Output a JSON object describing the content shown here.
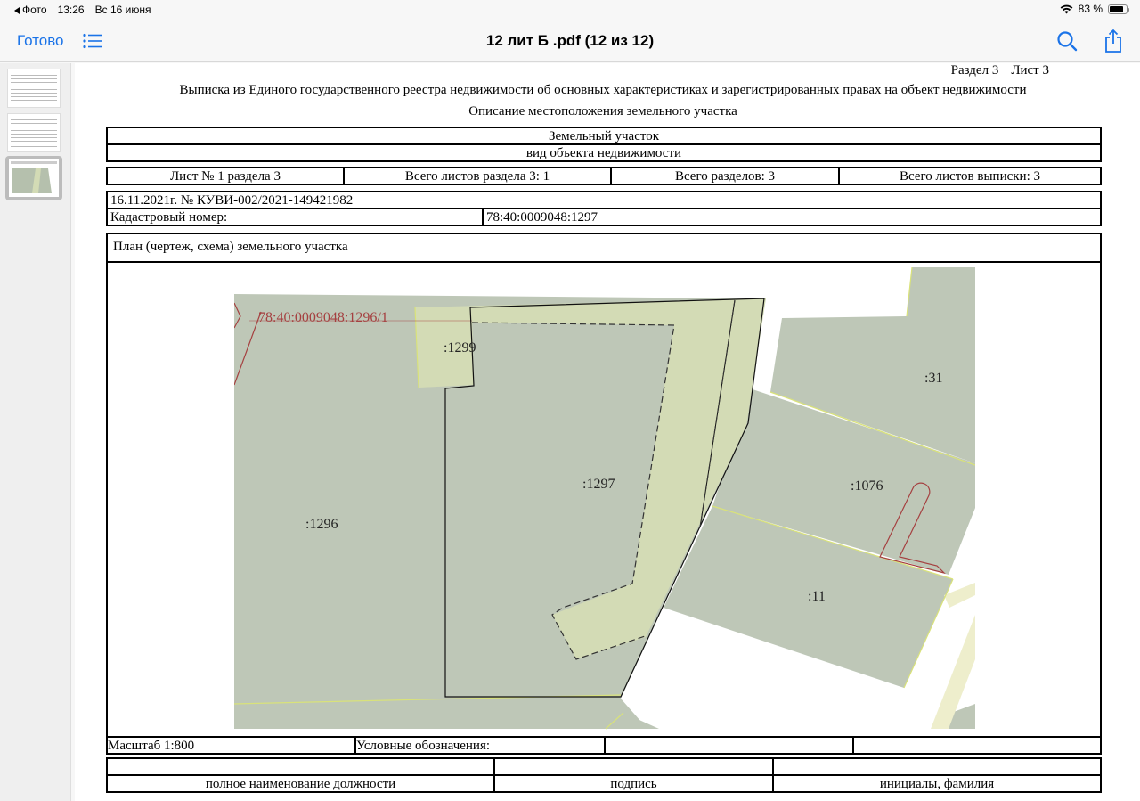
{
  "status": {
    "back_app": "Фото",
    "time": "13:26",
    "date": "Вс 16 июня",
    "battery": "83 %",
    "battery_level": 0.83
  },
  "nav": {
    "done_label": "Готово",
    "title": "12 лит Б .pdf (12 из 12)"
  },
  "thumbnails": [
    {
      "page": 1,
      "active": false
    },
    {
      "page": 2,
      "active": false
    },
    {
      "page": 3,
      "active": true
    }
  ],
  "doc": {
    "section_label": "Раздел 3",
    "sheet_label": "Лист 3",
    "title": "Выписка из Единого государственного реестра недвижимости об основных характеристиках и зарегистрированных правах на объект недвижимости",
    "subtitle": "Описание местоположения земельного участка",
    "object_name": "Земельный участок",
    "object_kind_label": "вид объекта недвижимости",
    "sheet_row": {
      "sheet_no": "Лист № 1 раздела 3",
      "total_sheets_section": "Всего листов раздела 3: 1",
      "total_sections": "Всего разделов: 3",
      "total_sheets": "Всего листов выписки: 3"
    },
    "ref_line": "16.11.2021г. № КУВИ-002/2021-149421982",
    "cadastral_label": "Кадастровый номер:",
    "cadastral_value": "78:40:0009048:1297",
    "plan_title": "План (чертеж, схема) земельного участка",
    "plan_labels": {
      "parcel_1296_1": "78:40:0009048:1296/1",
      "p1299": ":1299",
      "p1297": ":1297",
      "p1296": ":1296",
      "p31": ":31",
      "p1076": ":1076",
      "p11": ":11"
    },
    "scale": "Масштаб 1:800",
    "legend_label": "Условные обозначения:",
    "sign_row": {
      "position": "полное наименование должности",
      "signature": "подпись",
      "initials": "инициалы, фамилия"
    }
  },
  "colors": {
    "accent": "#1a73e8",
    "parcel_fill": "#bec7b7",
    "highlight_fill": "#d3dbb5",
    "red_line": "#a54040",
    "yellow_line": "#d9e27a"
  }
}
